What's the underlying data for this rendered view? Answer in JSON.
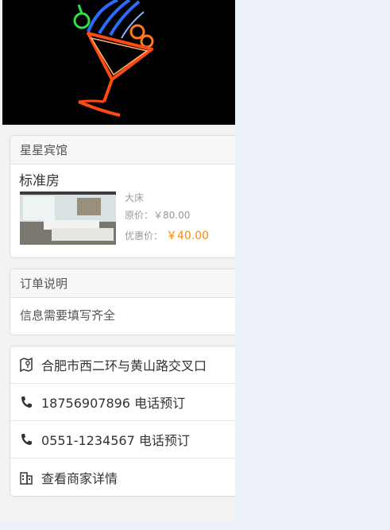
{
  "hotel": {
    "name": "星星宾馆",
    "room_name": "标准房",
    "bed_type": "大床",
    "original_label": "原价：",
    "original_price": "￥80.00",
    "sale_label": "优惠价：",
    "sale_price": "￥40.00"
  },
  "order_note": {
    "title": "订单说明",
    "text": "信息需要填写齐全"
  },
  "contact": {
    "address": "合肥市西二环与黄山路交叉口",
    "phone_mobile": "18756907896",
    "phone_mobile_action": "电话预订",
    "phone_landline": "0551-1234567",
    "phone_landline_action": "电话预订",
    "merchant_detail": "查看商家详情"
  },
  "colors": {
    "sale_price": "#ff8800",
    "background": "#edf2f9"
  },
  "icons": [
    "map-icon",
    "phone-icon",
    "building-icon"
  ]
}
